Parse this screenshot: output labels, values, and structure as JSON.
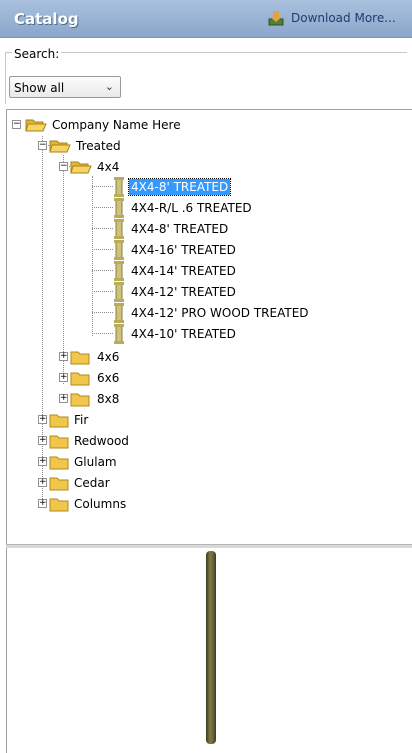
{
  "header": {
    "title": "Catalog",
    "download_label": "Download More..."
  },
  "search": {
    "legend": "Search:",
    "select_value": "Show all"
  },
  "tree": {
    "root": "Company Name Here",
    "treated": "Treated",
    "group_4x4": "4x4",
    "items": [
      "4X4-8' TREATED",
      "4X4-R/L .6 TREATED",
      "4X4-8' TREATED",
      "4X4-16' TREATED",
      "4X4-14' TREATED",
      "4X4-12' TREATED",
      "4X4-12' PRO WOOD TREATED",
      "4X4-10' TREATED"
    ],
    "subfolders": [
      "4x6",
      "6x6",
      "8x8"
    ],
    "folders": [
      "Fir",
      "Redwood",
      "Glulam",
      "Cedar",
      "Columns"
    ]
  },
  "colors": {
    "header_bg": "#9bb5d6",
    "selection": "#3399ff",
    "folder": "#f1c64c",
    "post": "#6f6a3b"
  }
}
